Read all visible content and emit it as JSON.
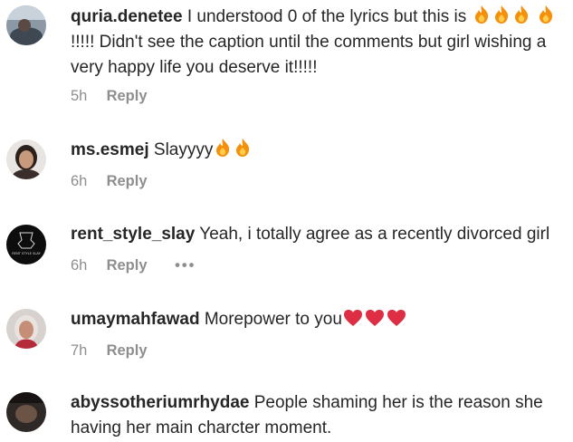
{
  "comments": [
    {
      "username": "quria.denetee",
      "text_before": " I understood 0 of the lyrics but this is",
      "text_after": "!!!!! Didn't see the caption until the comments but girl wishing a very happy life you deserve it!!!!!",
      "time": "5h",
      "reply": "Reply"
    },
    {
      "username": "ms.esmej",
      "text": " Slayyyy",
      "time": "6h",
      "reply": "Reply"
    },
    {
      "username": "rent_style_slay",
      "text": " Yeah, i totally agree as a recently divorced girl",
      "time": "6h",
      "reply": "Reply",
      "more": "•••",
      "avatar_text": "RENT STYLE SLAY"
    },
    {
      "username": "umaymahfawad",
      "text": " Morepower to you",
      "time": "7h",
      "reply": "Reply"
    },
    {
      "username": "abyssotheriumrhydae",
      "text": " People shaming her is the reason she having her main charcter moment."
    }
  ],
  "colors": {
    "text": "#262626",
    "meta": "#8e8e8e",
    "fire": "#f4900c",
    "heart": "#dd2e44"
  },
  "icons": [
    "fire-emoji-icon",
    "red-heart-emoji-icon",
    "more-options-icon"
  ]
}
